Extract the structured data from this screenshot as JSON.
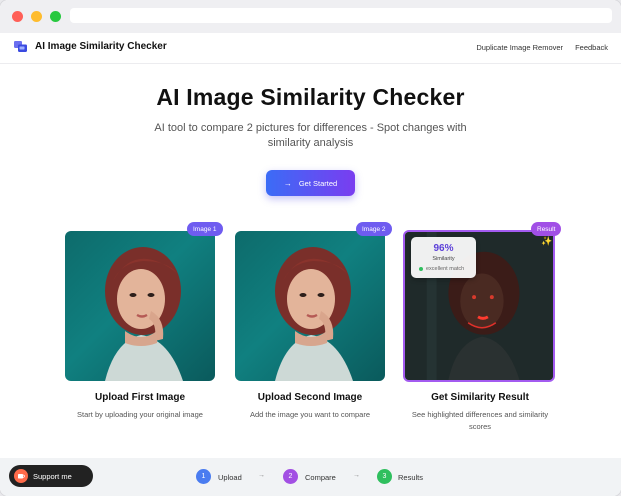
{
  "nav": {
    "brand": "AI Image Similarity Checker",
    "links": [
      "Duplicate Image Remover",
      "Feedback"
    ]
  },
  "hero": {
    "title": "AI Image Similarity Checker",
    "subtitle": "AI tool to compare 2 pictures for differences - Spot changes with similarity analysis",
    "cta": "Get Started"
  },
  "cards": [
    {
      "badge": "Image 1",
      "title": "Upload First Image",
      "desc": "Start by uploading your original image"
    },
    {
      "badge": "Image 2",
      "title": "Upload Second Image",
      "desc": "Add the image you want to compare"
    },
    {
      "badge": "Result",
      "title": "Get Similarity Result",
      "desc": "See highlighted differences and similarity scores"
    }
  ],
  "similarity": {
    "percent": "96%",
    "label": "Similarity",
    "match": "excellent match"
  },
  "support": "Support me",
  "steps": [
    {
      "num": "1",
      "label": "Upload",
      "color": "#4a7cf0"
    },
    {
      "num": "2",
      "label": "Compare",
      "color": "#a24fe3"
    },
    {
      "num": "3",
      "label": "Results",
      "color": "#2fbf5e"
    }
  ],
  "step_arrow": "→",
  "cta_arrow": "→",
  "sparkle": "✨"
}
